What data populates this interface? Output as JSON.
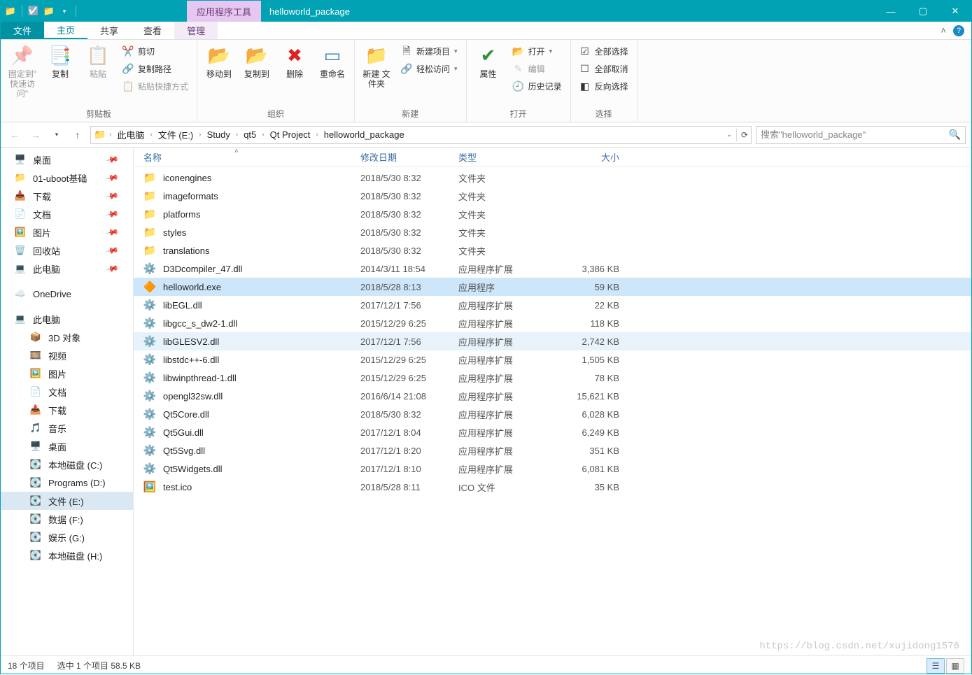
{
  "titlebar": {
    "contextual_tab": "应用程序工具",
    "title": "helloworld_package"
  },
  "window_controls": {
    "min": "—",
    "max": "▢",
    "close": "✕"
  },
  "ribbon_tabs": {
    "file": "文件",
    "home": "主页",
    "share": "共享",
    "view": "查看",
    "manage": "管理"
  },
  "ribbon": {
    "clipboard": {
      "pin": "固定到\"\n快速访问\"",
      "copy": "复制",
      "paste": "粘贴",
      "cut": "剪切",
      "copy_path": "复制路径",
      "paste_shortcut": "粘贴快捷方式",
      "title": "剪贴板"
    },
    "organize": {
      "move_to": "移动到",
      "copy_to": "复制到",
      "delete": "删除",
      "rename": "重命名",
      "title": "组织"
    },
    "new": {
      "new_folder": "新建\n文件夹",
      "new_item": "新建项目",
      "easy_access": "轻松访问",
      "title": "新建"
    },
    "open": {
      "properties": "属性",
      "open": "打开",
      "edit": "编辑",
      "history": "历史记录",
      "title": "打开"
    },
    "select": {
      "select_all": "全部选择",
      "select_none": "全部取消",
      "invert": "反向选择",
      "title": "选择"
    }
  },
  "breadcrumb": {
    "this_pc": "此电脑",
    "drive": "文件 (E:)",
    "p1": "Study",
    "p2": "qt5",
    "p3": "Qt Project",
    "p4": "helloworld_package"
  },
  "search_placeholder": "搜索\"helloworld_package\"",
  "sidebar": {
    "pinned": [
      {
        "label": "桌面",
        "icon": "🖥️",
        "pin": true
      },
      {
        "label": "01-uboot基础",
        "icon": "📁",
        "pin": true
      },
      {
        "label": "下载",
        "icon": "📥",
        "pin": true
      },
      {
        "label": "文档",
        "icon": "📄",
        "pin": true
      },
      {
        "label": "图片",
        "icon": "🖼️",
        "pin": true
      },
      {
        "label": "回收站",
        "icon": "🗑️",
        "pin": true
      },
      {
        "label": "此电脑",
        "icon": "💻",
        "pin": true
      }
    ],
    "onedrive": "OneDrive",
    "this_pc": "此电脑",
    "pc_items": [
      {
        "label": "3D 对象",
        "icon": "📦"
      },
      {
        "label": "视频",
        "icon": "🎞️"
      },
      {
        "label": "图片",
        "icon": "🖼️"
      },
      {
        "label": "文档",
        "icon": "📄"
      },
      {
        "label": "下载",
        "icon": "📥"
      },
      {
        "label": "音乐",
        "icon": "🎵"
      },
      {
        "label": "桌面",
        "icon": "🖥️"
      },
      {
        "label": "本地磁盘 (C:)",
        "icon": "💽"
      },
      {
        "label": "Programs (D:)",
        "icon": "💽"
      },
      {
        "label": "文件 (E:)",
        "icon": "💽",
        "selected": true
      },
      {
        "label": "数据 (F:)",
        "icon": "💽"
      },
      {
        "label": "娱乐 (G:)",
        "icon": "💽"
      },
      {
        "label": "本地磁盘 (H:)",
        "icon": "💽"
      }
    ]
  },
  "columns": {
    "name": "名称",
    "date": "修改日期",
    "type": "类型",
    "size": "大小"
  },
  "files": [
    {
      "name": "iconengines",
      "date": "2018/5/30 8:32",
      "type": "文件夹",
      "size": "",
      "kind": "folder"
    },
    {
      "name": "imageformats",
      "date": "2018/5/30 8:32",
      "type": "文件夹",
      "size": "",
      "kind": "folder"
    },
    {
      "name": "platforms",
      "date": "2018/5/30 8:32",
      "type": "文件夹",
      "size": "",
      "kind": "folder"
    },
    {
      "name": "styles",
      "date": "2018/5/30 8:32",
      "type": "文件夹",
      "size": "",
      "kind": "folder"
    },
    {
      "name": "translations",
      "date": "2018/5/30 8:32",
      "type": "文件夹",
      "size": "",
      "kind": "folder"
    },
    {
      "name": "D3Dcompiler_47.dll",
      "date": "2014/3/11 18:54",
      "type": "应用程序扩展",
      "size": "3,386 KB",
      "kind": "dll"
    },
    {
      "name": "helloworld.exe",
      "date": "2018/5/28 8:13",
      "type": "应用程序",
      "size": "59 KB",
      "kind": "exe",
      "selected": true
    },
    {
      "name": "libEGL.dll",
      "date": "2017/12/1 7:56",
      "type": "应用程序扩展",
      "size": "22 KB",
      "kind": "dll"
    },
    {
      "name": "libgcc_s_dw2-1.dll",
      "date": "2015/12/29 6:25",
      "type": "应用程序扩展",
      "size": "118 KB",
      "kind": "dll"
    },
    {
      "name": "libGLESV2.dll",
      "date": "2017/12/1 7:56",
      "type": "应用程序扩展",
      "size": "2,742 KB",
      "kind": "dll",
      "hover": true
    },
    {
      "name": "libstdc++-6.dll",
      "date": "2015/12/29 6:25",
      "type": "应用程序扩展",
      "size": "1,505 KB",
      "kind": "dll"
    },
    {
      "name": "libwinpthread-1.dll",
      "date": "2015/12/29 6:25",
      "type": "应用程序扩展",
      "size": "78 KB",
      "kind": "dll"
    },
    {
      "name": "opengl32sw.dll",
      "date": "2016/6/14 21:08",
      "type": "应用程序扩展",
      "size": "15,621 KB",
      "kind": "dll"
    },
    {
      "name": "Qt5Core.dll",
      "date": "2018/5/30 8:32",
      "type": "应用程序扩展",
      "size": "6,028 KB",
      "kind": "dll"
    },
    {
      "name": "Qt5Gui.dll",
      "date": "2017/12/1 8:04",
      "type": "应用程序扩展",
      "size": "6,249 KB",
      "kind": "dll"
    },
    {
      "name": "Qt5Svg.dll",
      "date": "2017/12/1 8:20",
      "type": "应用程序扩展",
      "size": "351 KB",
      "kind": "dll"
    },
    {
      "name": "Qt5Widgets.dll",
      "date": "2017/12/1 8:10",
      "type": "应用程序扩展",
      "size": "6,081 KB",
      "kind": "dll"
    },
    {
      "name": "test.ico",
      "date": "2018/5/28 8:11",
      "type": "ICO 文件",
      "size": "35 KB",
      "kind": "ico"
    }
  ],
  "status": {
    "item_count": "18 个项目",
    "selection": "选中 1 个项目  58.5 KB"
  },
  "watermark": "https://blog.csdn.net/xujidong1576"
}
